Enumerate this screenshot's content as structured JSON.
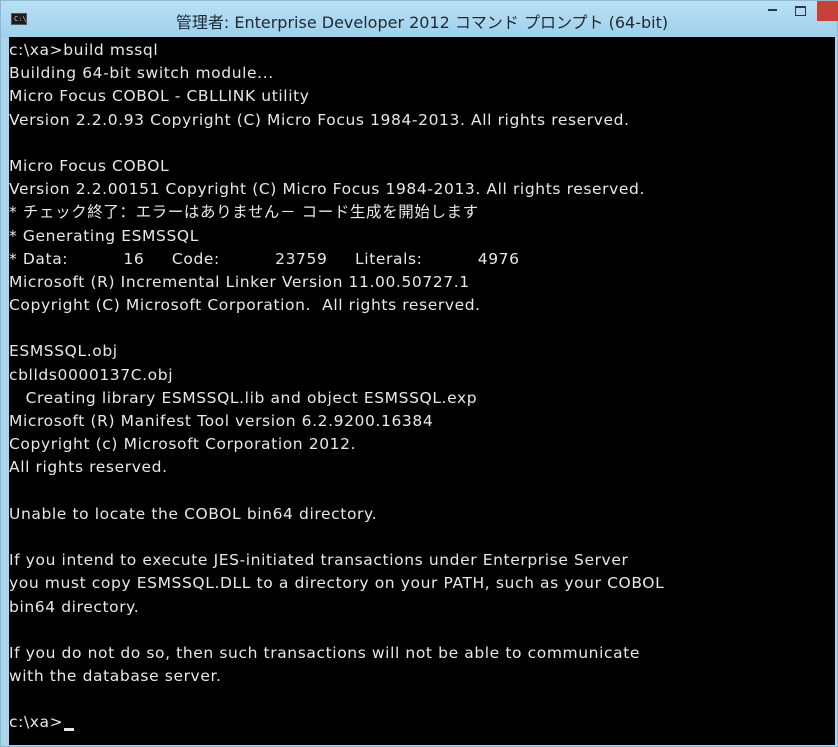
{
  "window": {
    "icon_text": "C:\\",
    "title": "管理者: Enterprise Developer 2012 コマンド プロンプト (64-bit)"
  },
  "console": {
    "lines": [
      "c:\\xa>build mssql",
      "Building 64-bit switch module...",
      "Micro Focus COBOL - CBLLINK utility",
      "Version 2.2.0.93 Copyright (C) Micro Focus 1984-2013. All rights reserved.",
      "",
      "Micro Focus COBOL",
      "Version 2.2.00151 Copyright (C) Micro Focus 1984-2013. All rights reserved.",
      "* チェック終了：エラーはありません－ コード生成を開始します",
      "* Generating ESMSSQL",
      "* Data:          16     Code:          23759     Literals:          4976",
      "Microsoft (R) Incremental Linker Version 11.00.50727.1",
      "Copyright (C) Microsoft Corporation.  All rights reserved.",
      "",
      "ESMSSQL.obj",
      "cbllds0000137C.obj",
      "   Creating library ESMSSQL.lib and object ESMSSQL.exp",
      "Microsoft (R) Manifest Tool version 6.2.9200.16384",
      "Copyright (c) Microsoft Corporation 2012.",
      "All rights reserved.",
      "",
      "Unable to locate the COBOL bin64 directory.",
      "",
      "If you intend to execute JES-initiated transactions under Enterprise Server",
      "you must copy ESMSSQL.DLL to a directory on your PATH, such as your COBOL",
      "bin64 directory.",
      "",
      "If you do not do so, then such transactions will not be able to communicate",
      "with the database server.",
      "",
      "c:\\xa>"
    ]
  }
}
